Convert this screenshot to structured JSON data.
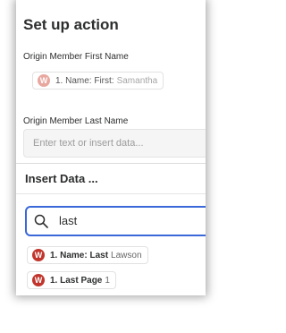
{
  "panel": {
    "title": "Set up action"
  },
  "fields": [
    {
      "label": "Origin Member First Name",
      "token": {
        "icon": "W",
        "step": "1. Name: First:",
        "value": "Samantha"
      }
    },
    {
      "label": "Origin Member Last Name",
      "placeholder": "Enter text or insert data..."
    }
  ],
  "insert_data": {
    "title": "Insert Data ...",
    "search_value": "last",
    "results": [
      {
        "icon": "W",
        "label": "1. Name: Last",
        "value": "Lawson"
      },
      {
        "icon": "W",
        "label": "1. Last Page",
        "value": "1"
      }
    ]
  },
  "colors": {
    "brand_icon": "#c1352c",
    "search_focus": "#3a68d8"
  }
}
